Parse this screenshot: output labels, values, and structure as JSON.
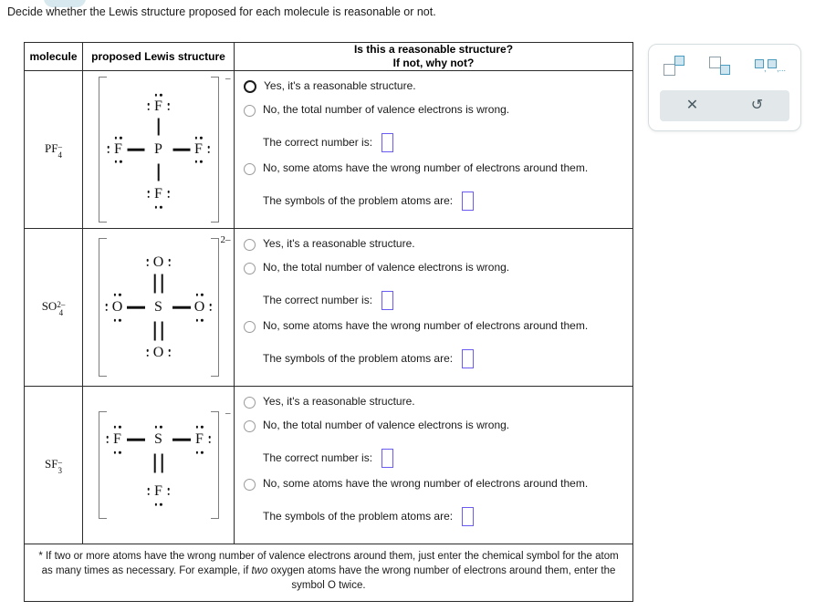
{
  "prompt": "Decide whether the Lewis structure proposed for each molecule is reasonable or not.",
  "table": {
    "headers": {
      "molecule": "molecule",
      "structure": "proposed Lewis structure",
      "question_line1": "Is this a reasonable structure?",
      "question_line2": "If not, why not?"
    },
    "rows": [
      {
        "molecule": {
          "formula": "PF",
          "subscript": "4",
          "charge": "–"
        },
        "lewis": {
          "center": "P",
          "bracket_charge": "–",
          "ligands": [
            {
              "symbol": "F",
              "position": "top",
              "bond": "single"
            },
            {
              "symbol": "F",
              "position": "left",
              "bond": "single"
            },
            {
              "symbol": "F",
              "position": "right",
              "bond": "single"
            },
            {
              "symbol": "F",
              "position": "bottom",
              "bond": "single"
            }
          ]
        },
        "options": [
          {
            "label": "Yes, it's a reasonable structure.",
            "state": "hover"
          },
          {
            "label": "No, the total number of valence electrons is wrong.",
            "state": "normal"
          },
          {
            "label": "No, some atoms have the wrong number of electrons around them.",
            "state": "normal"
          }
        ],
        "fields": [
          {
            "label": "The correct number is:",
            "value": ""
          },
          {
            "label": "The symbols of the problem atoms are:",
            "value": ""
          }
        ]
      },
      {
        "molecule": {
          "formula": "SO",
          "subscript": "4",
          "charge": "2–"
        },
        "lewis": {
          "center": "S",
          "bracket_charge": "2–",
          "ligands": [
            {
              "symbol": "O",
              "position": "top",
              "bond": "double"
            },
            {
              "symbol": "O",
              "position": "left",
              "bond": "single"
            },
            {
              "symbol": "O",
              "position": "right",
              "bond": "single"
            },
            {
              "symbol": "O",
              "position": "bottom",
              "bond": "double"
            }
          ]
        },
        "options": [
          {
            "label": "Yes, it's a reasonable structure.",
            "state": "normal"
          },
          {
            "label": "No, the total number of valence electrons is wrong.",
            "state": "normal"
          },
          {
            "label": "No, some atoms have the wrong number of electrons around them.",
            "state": "normal"
          }
        ],
        "fields": [
          {
            "label": "The correct number is:",
            "value": ""
          },
          {
            "label": "The symbols of the problem atoms are:",
            "value": ""
          }
        ]
      },
      {
        "molecule": {
          "formula": "SF",
          "subscript": "3",
          "charge": "–"
        },
        "lewis": {
          "center": "S",
          "bracket_charge": "–",
          "ligands": [
            {
              "symbol": "F",
              "position": "left",
              "bond": "single"
            },
            {
              "symbol": "F",
              "position": "right",
              "bond": "single"
            },
            {
              "symbol": "F",
              "position": "bottom",
              "bond": "double"
            }
          ]
        },
        "options": [
          {
            "label": "Yes, it's a reasonable structure.",
            "state": "normal"
          },
          {
            "label": "No, the total number of valence electrons is wrong.",
            "state": "normal"
          },
          {
            "label": "No, some atoms have the wrong number of electrons around them.",
            "state": "normal"
          }
        ],
        "fields": [
          {
            "label": "The correct number is:",
            "value": ""
          },
          {
            "label": "The symbols of the problem atoms are:",
            "value": ""
          }
        ]
      }
    ],
    "footnote_part1": "* If two or more atoms have the wrong number of valence electrons around them, just enter the chemical symbol for the atom as many times as necessary. For example, if ",
    "footnote_italic": "two",
    "footnote_part2": " oxygen atoms have the wrong number of electrons around them, enter the symbol O twice."
  },
  "palette": {
    "buttons": [
      {
        "name": "superscript-icon",
        "title": "superscript"
      },
      {
        "name": "subscript-icon",
        "title": "subscript"
      },
      {
        "name": "list-icon",
        "title": "list"
      }
    ],
    "actions": [
      {
        "name": "clear-icon",
        "glyph": "✕"
      },
      {
        "name": "undo-icon",
        "glyph": "↺"
      }
    ]
  },
  "colors": {
    "input_border": "#6a5cf0",
    "bracket": "#7d7d7d",
    "palette_bar": "#e2e7e9",
    "icon_blue": "#4a9cc0"
  }
}
